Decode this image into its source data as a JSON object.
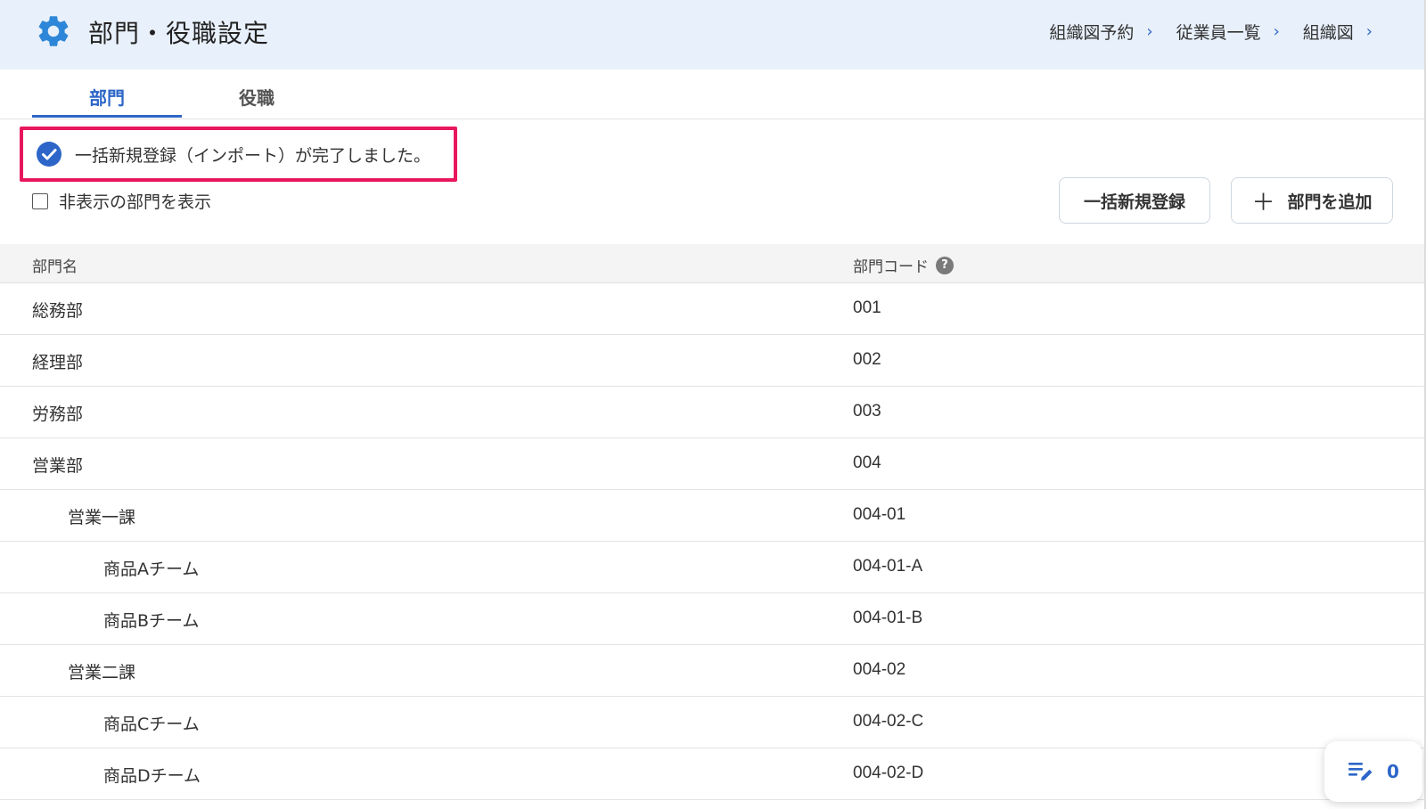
{
  "header": {
    "title": "部門・役職設定",
    "breadcrumbs": [
      {
        "label": "組織図予約"
      },
      {
        "label": "従業員一覧"
      },
      {
        "label": "組織図"
      }
    ]
  },
  "tabs": [
    {
      "label": "部門",
      "active": true
    },
    {
      "label": "役職",
      "active": false
    }
  ],
  "notice": {
    "message": "一括新規登録（インポート）が完了しました。",
    "icon": "check-circle-icon"
  },
  "filters": {
    "show_hidden_label": "非表示の部門を表示",
    "show_hidden_checked": false
  },
  "actions": {
    "bulk_register_label": "一括新規登録",
    "add_department_label": "部門を追加"
  },
  "table": {
    "columns": {
      "name": "部門名",
      "code": "部門コード"
    },
    "rows": [
      {
        "name": "総務部",
        "code": "001",
        "level": 0
      },
      {
        "name": "経理部",
        "code": "002",
        "level": 0
      },
      {
        "name": "労務部",
        "code": "003",
        "level": 0
      },
      {
        "name": "営業部",
        "code": "004",
        "level": 0
      },
      {
        "name": "営業一課",
        "code": "004-01",
        "level": 1
      },
      {
        "name": "商品Aチーム",
        "code": "004-01-A",
        "level": 2
      },
      {
        "name": "商品Bチーム",
        "code": "004-01-B",
        "level": 2
      },
      {
        "name": "営業二課",
        "code": "004-02",
        "level": 1
      },
      {
        "name": "商品Cチーム",
        "code": "004-02-C",
        "level": 2
      },
      {
        "name": "商品Dチーム",
        "code": "004-02-D",
        "level": 2
      }
    ]
  },
  "fab": {
    "count": "0",
    "icon": "edit-list-icon"
  },
  "colors": {
    "accent": "#2d66c8",
    "highlight_border": "#e8175d",
    "header_bg": "#e8f0fb"
  }
}
